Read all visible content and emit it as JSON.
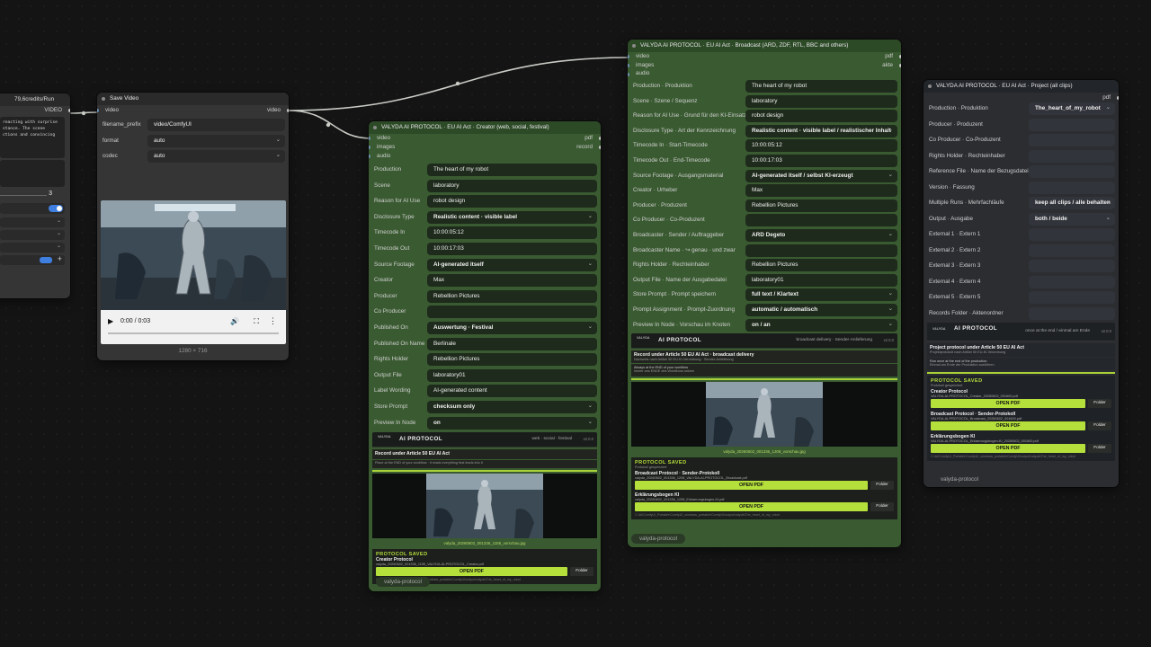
{
  "canvas": {
    "background": "#141414"
  },
  "partial_node": {
    "credits": "79,6credits/Run",
    "output": "VIDEO",
    "text_lines": [
      "reacting with surprise",
      "stance. The scene",
      "ctions and convincing"
    ],
    "counter": "3"
  },
  "save_video": {
    "title": "Save Video",
    "input_video": "video",
    "output_video": "video",
    "filename_prefix_label": "filename_prefix",
    "filename_prefix_value": "video/ComfyUI",
    "format_label": "format",
    "format_value": "auto",
    "codec_label": "codec",
    "codec_value": "auto",
    "time": "0:00 / 0:03",
    "resolution": "1280 × 716"
  },
  "creator": {
    "title": "VALYDA AI PROTOCOL · EU AI Act · Creator (web, social, festival)",
    "inputs": [
      "video",
      "images",
      "audio"
    ],
    "outputs": [
      "pdf",
      "record"
    ],
    "fields": [
      {
        "label": "Production",
        "value": "The heart of my robot",
        "select": false
      },
      {
        "label": "Scene",
        "value": "laboratory",
        "select": false
      },
      {
        "label": "Reason for AI Use",
        "value": "robot design",
        "select": false
      },
      {
        "label": "Disclosure Type",
        "value": "Realistic content · visible label",
        "select": true
      },
      {
        "label": "Timecode In",
        "value": "10:00:05:12",
        "select": false
      },
      {
        "label": "Timecode Out",
        "value": "10:00:17:03",
        "select": false
      },
      {
        "label": "Source Footage",
        "value": "AI-generated itself",
        "select": true
      },
      {
        "label": "Creator",
        "value": "Max",
        "select": false
      },
      {
        "label": "Producer",
        "value": "Rebellion Pictures",
        "select": false
      },
      {
        "label": "Co Producer",
        "value": "",
        "select": false
      },
      {
        "label": "Published On",
        "value": "Auswertung · Festival",
        "select": true
      },
      {
        "label": "Published On Name",
        "value": "Berlinale",
        "select": false
      },
      {
        "label": "Rights Holder",
        "value": "Rebellion Pictures",
        "select": false
      },
      {
        "label": "Output File",
        "value": "laboratory01",
        "select": false
      },
      {
        "label": "Label Wording",
        "value": "AI-generated content",
        "select": false
      },
      {
        "label": "Store Prompt",
        "value": "checksum only",
        "select": true
      },
      {
        "label": "Preview In Node",
        "value": "on",
        "select": true
      }
    ],
    "panel": {
      "logo": "VALYDA",
      "brand": "AI PROTOCOL",
      "tag": "web · social · festival",
      "version": "v2.0.0",
      "record_title": "Record under Article 50 EU AI Act",
      "record_sub": "Place at the END of your workflow · it reads everything that leads into it",
      "image_caption": "valyda_20260602_001336_1155_vorschau.jpg",
      "saved_heading": "PROTOCOL SAVED",
      "saved_item_name": "Creator Protocol",
      "saved_item_file": "valyda_20260602_001336_1155_VALYDA-AI-PROTOCOL_Creator.pdf",
      "open_label": "OPEN PDF",
      "folder_label": "Folder",
      "path": "C:\\AI\\ComfyUI_Portable\\ComfyUI_windows_portable\\ComfyUI\\output\\valyda\\The_heart_of_my_robot"
    },
    "footer": "valyda-protocol"
  },
  "broadcast": {
    "title": "VALYDA AI PROTOCOL · EU AI Act · Broadcast (ARD, ZDF, RTL, BBC and others)",
    "inputs": [
      "video",
      "images",
      "audio"
    ],
    "outputs": [
      "pdf",
      "akte"
    ],
    "fields": [
      {
        "label": "Production · Produktion",
        "value": "The heart of my robot",
        "select": false
      },
      {
        "label": "Scene · Szene / Sequenz",
        "value": "laboratory",
        "select": false
      },
      {
        "label": "Reason for AI Use · Grund für den KI-Einsatz",
        "value": "robot design",
        "select": false
      },
      {
        "label": "Disclosure Type · Art der Kennzeichnung",
        "value": "Realistic content · visible label / realistischer Inhalt",
        "select": true
      },
      {
        "label": "Timecode In · Start-Timecode",
        "value": "10:00:05:12",
        "select": false
      },
      {
        "label": "Timecode Out · End-Timecode",
        "value": "10:00:17:03",
        "select": false
      },
      {
        "label": "Source Footage · Ausgangsmaterial",
        "value": "AI-generated itself / selbst KI-erzeugt",
        "select": true
      },
      {
        "label": "Creator · Urheber",
        "value": "Max",
        "select": false
      },
      {
        "label": "Producer · Produzent",
        "value": "Rebellion Pictures",
        "select": false
      },
      {
        "label": "Co Producer · Co-Produzent",
        "value": "",
        "select": false
      },
      {
        "label": "Broadcaster · Sender / Auftraggeber",
        "value": "ARD Degeto",
        "select": true
      },
      {
        "label": "Broadcaster Name · ↪ genau · und zwar",
        "value": "",
        "select": false
      },
      {
        "label": "Rights Holder · Rechteinhaber",
        "value": "Rebellion Pictures",
        "select": false
      },
      {
        "label": "Output File · Name der Ausgabedatei",
        "value": "laboratory01",
        "select": false
      },
      {
        "label": "Store Prompt · Prompt speichern",
        "value": "full text / Klartext",
        "select": true
      },
      {
        "label": "Prompt Assignment · Prompt-Zuordnung",
        "value": "automatic / automatisch",
        "select": true
      },
      {
        "label": "Preview In Node · Vorschau im Knoten",
        "value": "on / an",
        "select": true
      }
    ],
    "panel": {
      "logo": "VALYDA",
      "brand": "AI PROTOCOL",
      "tag": "broadcast delivery · Sender-Anlieferung",
      "version": "v2.0.0",
      "record_title": "Record under Article 50 EU AI Act · broadcast delivery",
      "record_sub": "Nachweis nach Artikel 50 EU-KI-Verordnung · Sender-Anlieferung",
      "end_note": "Always at the END of your workflow",
      "end_note_sub": "immer ans ENDE des Workflows setzen",
      "image_caption": "valyda_20260602_001336_1208_vorschau.jpg",
      "saved_heading": "PROTOCOL SAVED",
      "saved_sub": "Protokoll gespeichert",
      "items": [
        {
          "name": "Broadcast Protocol · Sender-Protokoll",
          "file": "valyda_20260602_001336_1208_VALYDA-AI-PROTOCOL_Broadcast.pdf"
        },
        {
          "name": "Erklärungsbogen KI",
          "file": "valyda_20260602_001336_1208_Erklaerungsbogen-KI.pdf"
        }
      ],
      "open_label": "OPEN PDF",
      "folder_label": "Folder",
      "path": "C:\\AI\\ComfyUI_Portable\\ComfyUI_windows_portable\\ComfyUI\\output\\valyda\\The_heart_of_my_robot"
    },
    "footer": "valyda-protocol"
  },
  "project": {
    "title": "VALYDA AI PROTOCOL · EU AI Act · Project (all clips)",
    "outputs": [
      "pdf"
    ],
    "fields": [
      {
        "label": "Production · Produktion",
        "value": "The_heart_of_my_robot",
        "select": true
      },
      {
        "label": "Producer · Produzent",
        "value": "",
        "select": false
      },
      {
        "label": "Co Producer · Co-Produzent",
        "value": "",
        "select": false
      },
      {
        "label": "Rights Holder · Rechteinhaber",
        "value": "",
        "select": false
      },
      {
        "label": "Reference File · Name der Bezugsdatei",
        "value": "",
        "select": false
      },
      {
        "label": "Version · Fassung",
        "value": "",
        "select": false
      },
      {
        "label": "Multiple Runs · Mehrfachläufe",
        "value": "keep all clips / alle behalten",
        "select": true
      },
      {
        "label": "Output · Ausgabe",
        "value": "both / beide",
        "select": true
      },
      {
        "label": "External 1 · Extern 1",
        "value": "",
        "select": false
      },
      {
        "label": "External 2 · Extern 2",
        "value": "",
        "select": false
      },
      {
        "label": "External 3 · Extern 3",
        "value": "",
        "select": false
      },
      {
        "label": "External 4 · Extern 4",
        "value": "",
        "select": false
      },
      {
        "label": "External 5 · Extern 5",
        "value": "",
        "select": false
      },
      {
        "label": "Records Folder · Aktenordner",
        "value": "",
        "select": false
      }
    ],
    "panel": {
      "logo": "VALYDA",
      "brand": "AI PROTOCOL",
      "tag": "once at the end / einmal am Ende",
      "version": "v2.0.0",
      "record_title": "Project protocol under Article 50 EU AI Act",
      "record_sub": "Projektprotokoll nach Artikel 50 EU-KI-Verordnung",
      "end_note": "Run once at the end of the production",
      "end_note_sub": "Einmal am Ende der Produktion ausführen",
      "saved_heading": "PROTOCOL SAVED",
      "saved_sub": "Protokoll gespeichert",
      "items": [
        {
          "name": "Creator Protocol",
          "file": "VALYDA-AI-PROTOCOL_Creator_20260602_001600.pdf"
        },
        {
          "name": "Broadcast Protocol · Sender-Protokoll",
          "file": "VALYDA-AI-PROTOCOL_Broadcast_20260602_001600.pdf"
        },
        {
          "name": "Erklärungsbogen KI",
          "file": "VALYDA-AI-PROTOCOL_Erklaerungsbogen-KI_20260602_001600.pdf"
        }
      ],
      "open_label": "OPEN PDF",
      "folder_label": "Folder",
      "path": "C:\\AI\\ComfyUI_Portable\\ComfyUI_windows_portable\\ComfyUI\\output\\valyda\\The_heart_of_my_robot"
    },
    "footer": "valyda-protocol"
  },
  "colors": {
    "accent": "#b5e03b",
    "green_node": "#3a5b31",
    "gray_node": "#353535"
  }
}
